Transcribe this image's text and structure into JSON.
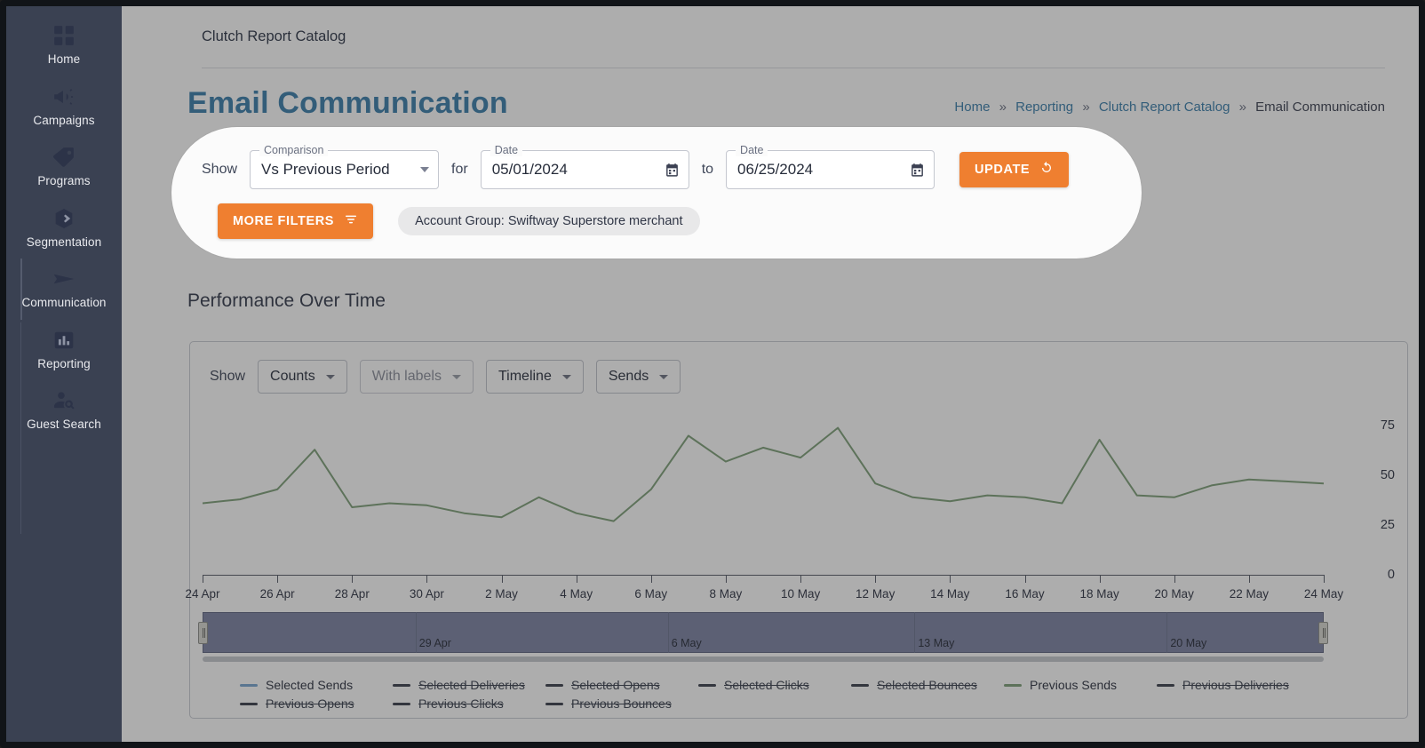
{
  "sidebar": {
    "items": [
      {
        "label": "Home",
        "icon": "grid-icon",
        "name": "home"
      },
      {
        "label": "Campaigns",
        "icon": "megaphone-icon",
        "name": "campaigns"
      },
      {
        "label": "Programs",
        "icon": "tag-icon",
        "name": "programs"
      },
      {
        "label": "Segmentation",
        "icon": "segment-icon",
        "name": "segmentation"
      },
      {
        "label": "Communication",
        "icon": "send-icon",
        "name": "communication"
      },
      {
        "label": "Reporting",
        "icon": "bar-chart-icon",
        "name": "reporting"
      },
      {
        "label": "Guest Search",
        "icon": "person-search-icon",
        "name": "guest-search"
      }
    ]
  },
  "topbar": {
    "app_title": "Clutch Report Catalog"
  },
  "header": {
    "page_title": "Email Communication",
    "breadcrumb": [
      {
        "label": "Home",
        "link": true
      },
      {
        "label": "Reporting",
        "link": true
      },
      {
        "label": "Clutch Report Catalog",
        "link": true
      },
      {
        "label": "Email Communication",
        "link": false
      }
    ],
    "separator": "»"
  },
  "filters": {
    "show_label": "Show",
    "comparison": {
      "legend": "Comparison",
      "value": "Vs Previous Period"
    },
    "for_label": "for",
    "date_from": {
      "legend": "Date",
      "value": "05/01/2024"
    },
    "to_label": "to",
    "date_to": {
      "legend": "Date",
      "value": "06/25/2024"
    },
    "update_label": "UPDATE",
    "more_filters_label": "MORE FILTERS",
    "chip": "Account Group: Swiftway Superstore merchant",
    "accent_color": "#ef7f30"
  },
  "chart_section": {
    "title": "Performance Over Time",
    "show_label": "Show",
    "controls": [
      {
        "label": "Counts",
        "disabled": false,
        "name": "counts"
      },
      {
        "label": "With labels",
        "disabled": true,
        "name": "with-labels"
      },
      {
        "label": "Timeline",
        "disabled": false,
        "name": "timeline"
      },
      {
        "label": "Sends",
        "disabled": false,
        "name": "sends"
      }
    ]
  },
  "range_slider": {
    "labels": [
      "29 Apr",
      "6 May",
      "13 May",
      "20 May"
    ],
    "label_positions": [
      19,
      41.5,
      63.5,
      86
    ]
  },
  "chart_data": {
    "type": "line",
    "title": "Performance Over Time",
    "xlabel": "",
    "ylabel": "",
    "ylim": [
      0,
      85
    ],
    "yticks": [
      0,
      25,
      50,
      75
    ],
    "grid": false,
    "legend_position": "bottom",
    "categories": [
      "24 Apr",
      "25 Apr",
      "26 Apr",
      "27 Apr",
      "28 Apr",
      "29 Apr",
      "30 Apr",
      "1 May",
      "2 May",
      "3 May",
      "4 May",
      "5 May",
      "6 May",
      "7 May",
      "8 May",
      "9 May",
      "10 May",
      "11 May",
      "12 May",
      "13 May",
      "14 May",
      "15 May",
      "16 May",
      "17 May",
      "18 May",
      "19 May",
      "20 May",
      "21 May",
      "22 May",
      "23 May",
      "24 May"
    ],
    "tick_labels": [
      "24 Apr",
      "26 Apr",
      "28 Apr",
      "30 Apr",
      "2 May",
      "4 May",
      "6 May",
      "8 May",
      "10 May",
      "12 May",
      "14 May",
      "16 May",
      "18 May",
      "20 May",
      "22 May",
      "24 May"
    ],
    "series": [
      {
        "name": "Previous Sends",
        "color": "#7fa07a",
        "visible": true,
        "values": [
          36,
          38,
          43,
          63,
          34,
          36,
          35,
          31,
          29,
          39,
          31,
          27,
          43,
          70,
          57,
          64,
          59,
          74,
          46,
          39,
          37,
          40,
          39,
          36,
          68,
          40,
          39,
          45,
          48,
          47,
          46
        ]
      },
      {
        "name": "Selected Sends",
        "color": "#7aa7d0",
        "visible": false,
        "values": []
      },
      {
        "name": "Selected Deliveries",
        "color": "#3a3f4d",
        "visible": false,
        "values": []
      },
      {
        "name": "Selected Opens",
        "color": "#3a3f4d",
        "visible": false,
        "values": []
      },
      {
        "name": "Selected Clicks",
        "color": "#3a3f4d",
        "visible": false,
        "values": []
      },
      {
        "name": "Selected Bounces",
        "color": "#3a3f4d",
        "visible": false,
        "values": []
      },
      {
        "name": "Previous Deliveries",
        "color": "#3a3f4d",
        "visible": false,
        "values": []
      },
      {
        "name": "Previous Opens",
        "color": "#3a3f4d",
        "visible": false,
        "values": []
      },
      {
        "name": "Previous Clicks",
        "color": "#3a3f4d",
        "visible": false,
        "values": []
      },
      {
        "name": "Previous Bounces",
        "color": "#3a3f4d",
        "visible": false,
        "values": []
      }
    ],
    "legend": [
      {
        "label": "Selected Sends",
        "color": "#7aa7d0",
        "active": true
      },
      {
        "label": "Selected Deliveries",
        "color": "#3a3f4d",
        "active": false
      },
      {
        "label": "Selected Opens",
        "color": "#3a3f4d",
        "active": false
      },
      {
        "label": "Selected Clicks",
        "color": "#3a3f4d",
        "active": false
      },
      {
        "label": "Selected Bounces",
        "color": "#3a3f4d",
        "active": false
      },
      {
        "label": "Previous Sends",
        "color": "#7fa07a",
        "active": true
      },
      {
        "label": "Previous Deliveries",
        "color": "#3a3f4d",
        "active": false
      },
      {
        "label": "Previous Opens",
        "color": "#3a3f4d",
        "active": false
      },
      {
        "label": "Previous Clicks",
        "color": "#3a3f4d",
        "active": false
      },
      {
        "label": "Previous Bounces",
        "color": "#3a3f4d",
        "active": false
      }
    ]
  }
}
